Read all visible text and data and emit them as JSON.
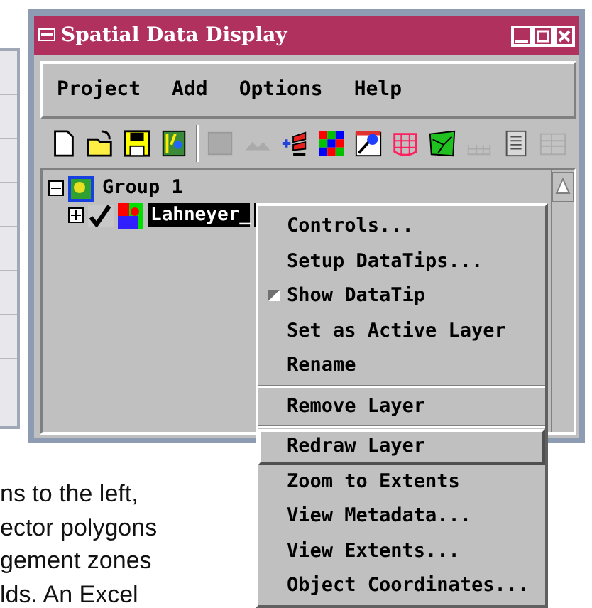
{
  "window": {
    "title": "Spatial Data Display"
  },
  "menubar": [
    "Project",
    "Add",
    "Options",
    "Help"
  ],
  "toolbar": [
    {
      "kind": "new",
      "disabled": false
    },
    {
      "kind": "open",
      "disabled": false
    },
    {
      "kind": "save",
      "disabled": false
    },
    {
      "kind": "wizard",
      "disabled": false
    },
    {
      "kind": "sep"
    },
    {
      "kind": "raster",
      "disabled": true
    },
    {
      "kind": "layers",
      "disabled": true
    },
    {
      "kind": "addlayer",
      "disabled": false
    },
    {
      "kind": "checker",
      "disabled": false
    },
    {
      "kind": "pin",
      "disabled": false
    },
    {
      "kind": "grid",
      "disabled": false
    },
    {
      "kind": "map",
      "disabled": false
    },
    {
      "kind": "scale",
      "disabled": true
    },
    {
      "kind": "doc",
      "disabled": false
    },
    {
      "kind": "table",
      "disabled": true
    }
  ],
  "tree": [
    {
      "label": "Group 1",
      "expanded": true,
      "selected": false,
      "children": [
        {
          "label": "Lahneyer_",
          "expanded": false,
          "visible": true,
          "selected": true
        }
      ]
    }
  ],
  "context_menu": [
    {
      "kind": "item",
      "label": "Controls...",
      "highlighted": false
    },
    {
      "kind": "item",
      "label": "Setup DataTips...",
      "highlighted": false
    },
    {
      "kind": "toggle",
      "label": "Show DataTip",
      "checked": true,
      "highlighted": false
    },
    {
      "kind": "item",
      "label": "Set as Active Layer",
      "highlighted": false
    },
    {
      "kind": "item",
      "label": "Rename",
      "highlighted": false
    },
    {
      "kind": "separator"
    },
    {
      "kind": "item",
      "label": "Remove Layer",
      "highlighted": false
    },
    {
      "kind": "separator"
    },
    {
      "kind": "item",
      "label": "Redraw Layer",
      "highlighted": true
    },
    {
      "kind": "item",
      "label": "Zoom to Extents",
      "highlighted": false
    },
    {
      "kind": "item",
      "label": "View Metadata...",
      "highlighted": false
    },
    {
      "kind": "item",
      "label": "View Extents...",
      "highlighted": false
    },
    {
      "kind": "item",
      "label": "Object Coordinates...",
      "highlighted": false
    }
  ],
  "body_text": [
    "ns to the left,",
    "ector polygons",
    "gement zones",
    "lds.  An Excel"
  ]
}
